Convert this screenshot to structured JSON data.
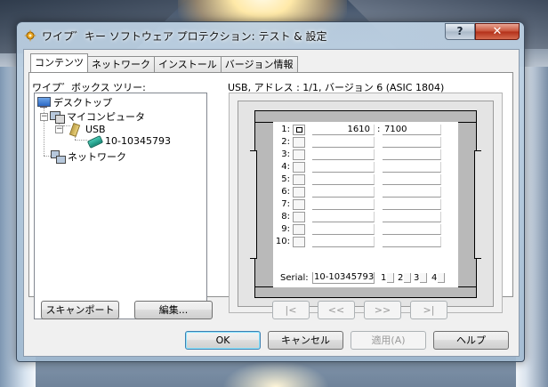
{
  "window": {
    "title": "ワイプ゛キー ソフトウェア プロテクション: テスト & 設定",
    "help_label": "?",
    "close_label": "✕"
  },
  "tabs": [
    {
      "label": "コンテンツ",
      "active": true
    },
    {
      "label": "ネットワーク",
      "active": false
    },
    {
      "label": "インストール",
      "active": false
    },
    {
      "label": "バージョン情報",
      "active": false
    }
  ],
  "tree": {
    "label": "ワイプ゛ボックス ツリー:",
    "items": [
      {
        "label": "デスクトップ",
        "icon": "desktop-icon"
      },
      {
        "label": "マイコンピュータ",
        "icon": "computer-icon",
        "toggle": "−"
      },
      {
        "label": "USB",
        "icon": "usb-icon",
        "toggle": "−"
      },
      {
        "label": "10-10345793",
        "icon": "key-icon"
      },
      {
        "label": "ネットワーク",
        "icon": "network-icon"
      }
    ]
  },
  "device": {
    "title": "USB, アドレス : 1/1, バージョン 6 (ASIC 1804)",
    "rows": [
      {
        "num": "1:",
        "a": "1610",
        "b": "7100",
        "checked": true
      },
      {
        "num": "2:",
        "a": "",
        "b": ""
      },
      {
        "num": "3:",
        "a": "",
        "b": ""
      },
      {
        "num": "4:",
        "a": "",
        "b": ""
      },
      {
        "num": "5:",
        "a": "",
        "b": ""
      },
      {
        "num": "6:",
        "a": "",
        "b": ""
      },
      {
        "num": "7:",
        "a": "",
        "b": ""
      },
      {
        "num": "8:",
        "a": "",
        "b": ""
      },
      {
        "num": "9:",
        "a": "",
        "b": ""
      },
      {
        "num": "10:",
        "a": "",
        "b": ""
      }
    ],
    "serial_label": "Serial:",
    "serial_value": "10-10345793",
    "ports": [
      "1",
      "2",
      "3",
      "4"
    ]
  },
  "buttons": {
    "scan_port": "スキャンポート",
    "edit": "編集...",
    "nav_first": "|<",
    "nav_prev": "<<",
    "nav_next": ">>",
    "nav_last": ">|",
    "ok": "OK",
    "cancel": "キャンセル",
    "apply": "適用(A)",
    "help": "ヘルプ"
  }
}
